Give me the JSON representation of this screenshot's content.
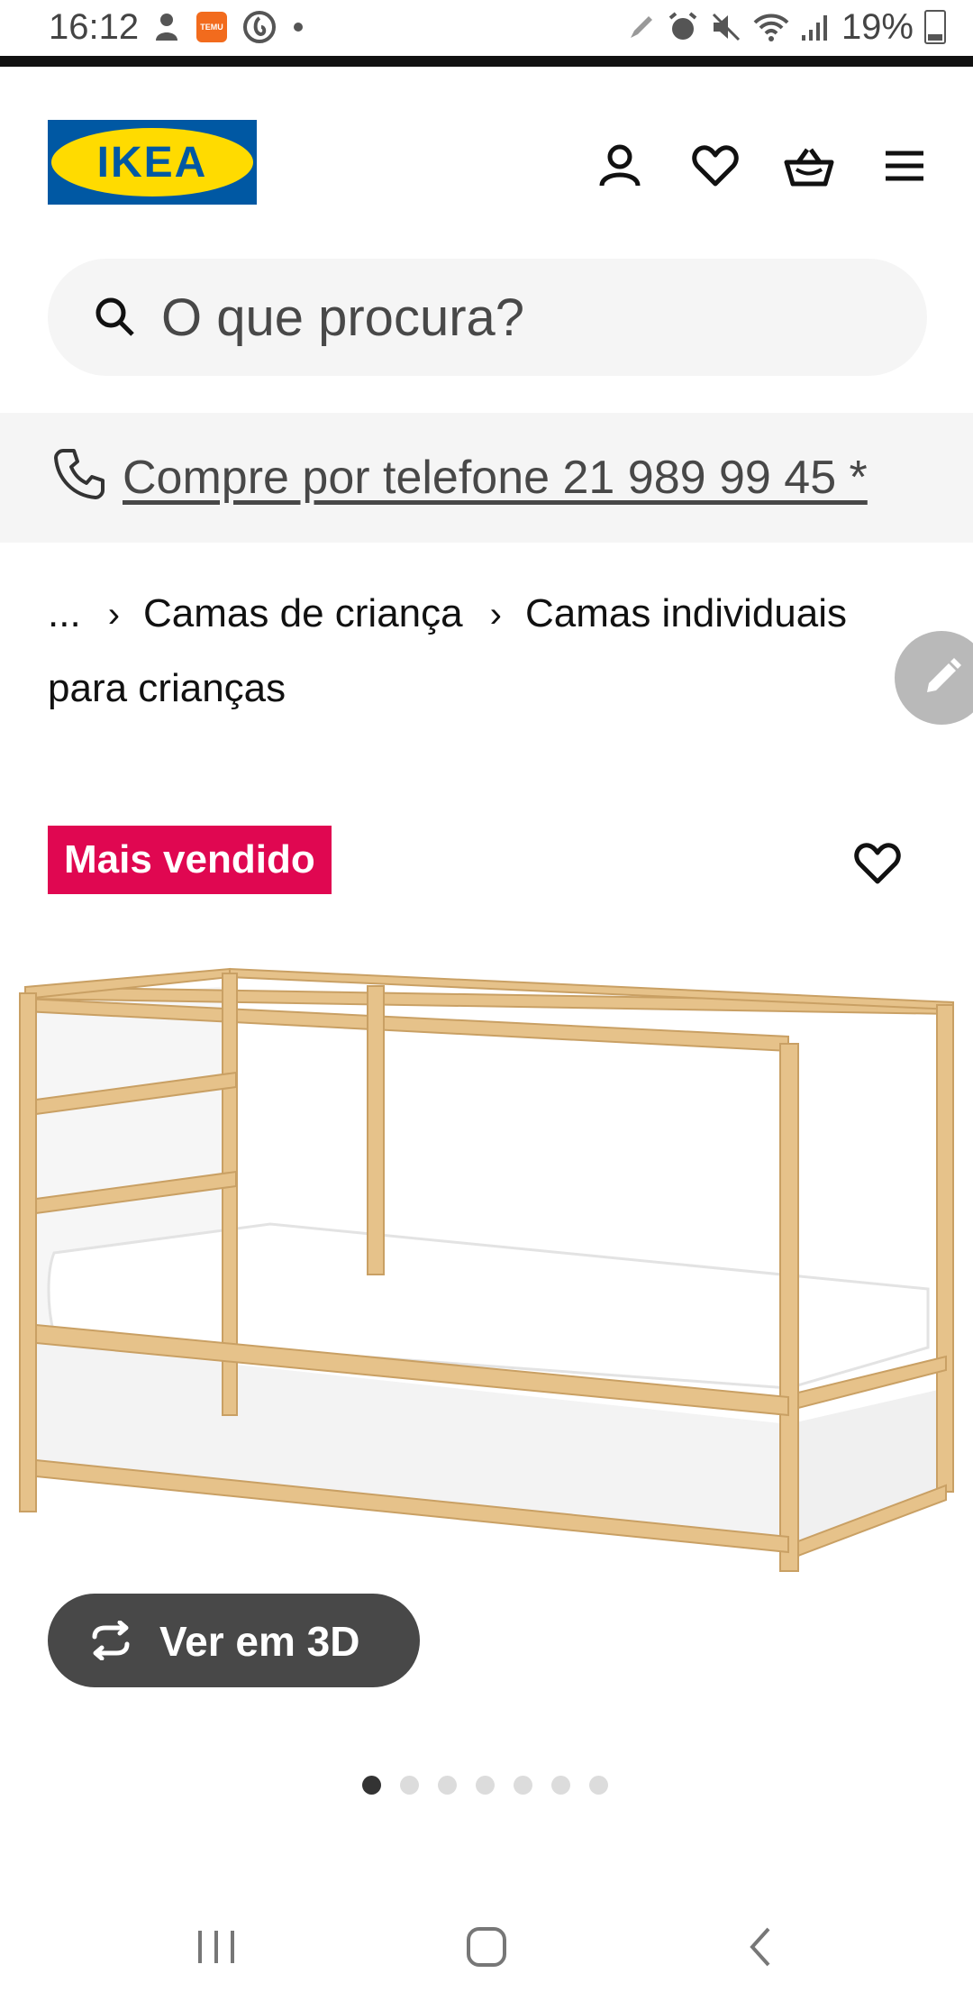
{
  "status_bar": {
    "time": "16:12",
    "left_icons": [
      "profile-icon",
      "temu-app-icon",
      "vodafone-icon",
      "dot-icon"
    ],
    "temu_label": "TEMU",
    "right_icons": [
      "pen-icon",
      "alarm-icon",
      "mute-icon",
      "wifi-icon",
      "signal-icon"
    ],
    "battery": "19%"
  },
  "header": {
    "logo_text": "IKEA",
    "icons": [
      "account-icon",
      "wishlist-heart-icon",
      "basket-icon",
      "menu-icon"
    ]
  },
  "search": {
    "placeholder": "O que procura?"
  },
  "phone_banner": {
    "text": "Compre por telefone 21 989 99 45 *"
  },
  "breadcrumb": {
    "items": [
      "...",
      "Camas de criança",
      "Camas individuais para crianças"
    ]
  },
  "product": {
    "badge": "Mais vendido",
    "view_3d_label": "Ver em 3D",
    "image_count": 7,
    "active_image_index": 0
  },
  "colors": {
    "ikea_blue": "#0058a3",
    "ikea_yellow": "#ffdb00",
    "badge_red": "#e00751",
    "button_dark": "#484848"
  },
  "navbar": {
    "icons": [
      "recent-apps-icon",
      "home-icon",
      "back-icon"
    ]
  }
}
